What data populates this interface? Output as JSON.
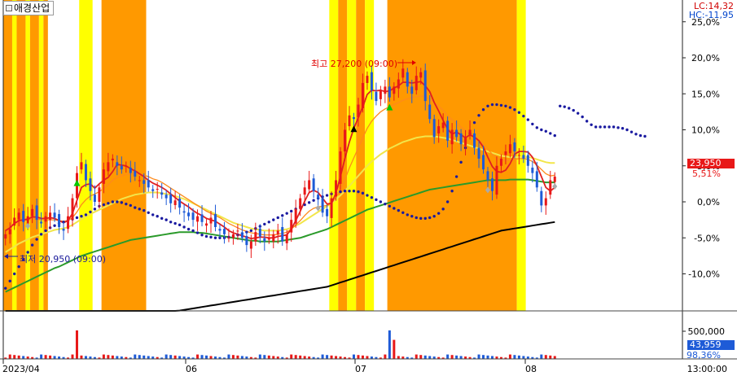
{
  "header": {
    "stock_name": "애경산업",
    "lc_label": "LC:14,32",
    "hc_label": "HC:-11,95"
  },
  "price_axis": {
    "ticks": [
      "25,0%",
      "20,0%",
      "15,0%",
      "10,0%",
      "5,0%",
      "0,0%",
      "-5,0%",
      "-10,0%"
    ]
  },
  "volume_axis": {
    "ticks": [
      "500,000"
    ]
  },
  "current": {
    "price": "23,950",
    "pct": "5,51%",
    "volume": "43,959",
    "volume_pct": "98,36%"
  },
  "annotations": {
    "high": "최고 27,200 (09:00)",
    "low": "최저 20,950 (09:00)"
  },
  "x_axis": {
    "labels": [
      "2023/04",
      "06",
      "07",
      "08"
    ],
    "time": "13:00:00"
  },
  "colors": {
    "up": "#e81818",
    "down": "#1e5bd7",
    "band_orange": "#ff9900",
    "band_yellow": "#ffff00",
    "ma_red": "#e02020",
    "ma_orange": "#ff8a1a",
    "ma_yellow": "#f2e64a",
    "ma_green": "#2a9a2a",
    "ma_black": "#000000",
    "parabolic_sar": "#1a1aa0"
  },
  "chart_data": {
    "type": "line",
    "price": {
      "units": "% change",
      "close_pct": [
        -4.5,
        -3.8,
        -2.2,
        -1.5,
        -2.8,
        -2.0,
        -1.0,
        -2.5,
        -3.0,
        -2.0,
        -1.5,
        -2.2,
        -3.5,
        -4.0,
        -2.0,
        0.5,
        4.0,
        5.5,
        3.0,
        1.5,
        0.0,
        2.0,
        4.5,
        5.5,
        6.0,
        5.0,
        4.5,
        5.0,
        4.0,
        3.5,
        3.0,
        2.5,
        2.0,
        1.5,
        1.8,
        1.0,
        0.5,
        -0.2,
        0.2,
        -0.8,
        -1.5,
        -2.0,
        -2.5,
        -2.0,
        -2.8,
        -3.0,
        -2.2,
        -3.5,
        -4.0,
        -4.5,
        -5.0,
        -4.5,
        -4.0,
        -5.0,
        -6.0,
        -5.5,
        -4.2,
        -4.8,
        -5.5,
        -5.0,
        -4.5,
        -4.0,
        -5.5,
        -4.5,
        -2.5,
        -1.0,
        0.5,
        2.0,
        3.0,
        1.5,
        0.5,
        -1.5,
        -2.0,
        0.5,
        3.0,
        7.0,
        10.0,
        12.0,
        11.5,
        13.5,
        16.5,
        17.5,
        15.5,
        14.0,
        15.5,
        16.0,
        14.5,
        16.0,
        17.0,
        18.5,
        16.0,
        15.0,
        17.5,
        18.0,
        14.0,
        11.5,
        9.0,
        10.5,
        11.0,
        8.5,
        10.0,
        9.0,
        8.0,
        9.0,
        10.0,
        7.5,
        6.0,
        4.5,
        3.0,
        1.5,
        5.0,
        6.0,
        7.0,
        8.0,
        7.0,
        6.5,
        6.0,
        5.0,
        4.0,
        2.0,
        -0.5,
        0.5,
        3.0,
        3.5
      ],
      "ma_red": [
        -4.0,
        -3.6,
        -3.0,
        -2.6,
        -2.5,
        -2.4,
        -2.1,
        -2.1,
        -2.3,
        -2.3,
        -2.2,
        -2.3,
        -2.6,
        -2.9,
        -2.6,
        -1.6,
        0.2,
        2.0,
        2.4,
        2.5,
        1.9,
        2.5,
        3.0,
        3.4,
        4.2,
        5.2,
        5.1,
        5.0,
        4.6,
        4.3,
        3.9,
        3.5,
        3.0,
        2.6,
        2.3,
        2.0,
        1.6,
        1.1,
        0.6,
        0.1,
        -0.3,
        -0.7,
        -1.2,
        -1.6,
        -1.9,
        -2.3,
        -2.5,
        -2.7,
        -3.1,
        -3.5,
        -4.0,
        -4.3,
        -4.5,
        -4.7,
        -4.9,
        -5.1,
        -5.0,
        -4.9,
        -4.9,
        -5.0,
        -5.0,
        -4.8,
        -4.7,
        -4.6,
        -3.8,
        -2.6,
        -1.3,
        0.1,
        1.3,
        1.6,
        1.3,
        0.5,
        -0.3,
        -0.2,
        1.2,
        3.5,
        6.0,
        8.3,
        10.2,
        11.7,
        13.2,
        14.9,
        15.5,
        15.4,
        15.5,
        15.3,
        15.4,
        15.8,
        16.1,
        16.6,
        16.6,
        16.5,
        16.6,
        16.7,
        16.1,
        15.3,
        13.8,
        12.6,
        11.3,
        10.1,
        9.4,
        9.7,
        9.3,
        8.9,
        9.3,
        9.0,
        8.5,
        7.6,
        6.2,
        4.9,
        4.2,
        4.1,
        4.4,
        5.3,
        6.6,
        7.0,
        7.0,
        6.9,
        6.2,
        5.0,
        3.5,
        2.0,
        1.5,
        2.0
      ],
      "ma_orange": [
        -3.5,
        -3.3,
        -3.0,
        -2.7,
        -2.6,
        -2.5,
        -2.4,
        -2.4,
        -2.5,
        -2.5,
        -2.5,
        -2.5,
        -2.6,
        -2.7,
        -2.6,
        -2.2,
        -1.4,
        -0.4,
        0.3,
        0.8,
        1.1,
        1.4,
        1.9,
        2.4,
        3.0,
        3.4,
        3.6,
        3.8,
        3.9,
        3.9,
        3.8,
        3.7,
        3.5,
        3.2,
        3.0,
        2.7,
        2.3,
        1.9,
        1.5,
        1.1,
        0.7,
        0.3,
        -0.1,
        -0.5,
        -0.9,
        -1.3,
        -1.6,
        -1.9,
        -2.2,
        -2.6,
        -3.0,
        -3.3,
        -3.6,
        -3.9,
        -4.1,
        -4.3,
        -4.4,
        -4.5,
        -4.6,
        -4.6,
        -4.6,
        -4.5,
        -4.4,
        -4.2,
        -3.8,
        -3.2,
        -2.6,
        -1.9,
        -1.3,
        -0.9,
        -0.7,
        -0.6,
        -0.5,
        -0.2,
        0.6,
        1.7,
        3.1,
        4.7,
        6.1,
        7.5,
        8.9,
        10.2,
        11.2,
        11.9,
        12.5,
        12.9,
        13.2,
        13.5,
        13.8,
        14.1,
        14.3,
        14.5,
        14.6,
        14.7,
        14.6,
        14.3,
        13.8,
        13.3,
        12.7,
        12.0,
        11.4,
        10.9,
        10.4,
        9.9,
        9.5,
        9.1,
        8.6,
        8.0,
        7.3,
        6.6,
        6.1,
        5.8,
        5.7,
        5.8,
        5.9,
        6.0,
        6.0,
        5.9,
        5.6,
        5.1,
        4.5,
        3.9,
        3.6,
        3.7
      ],
      "ma_yellow": [
        -7.0,
        -6.6,
        -6.2,
        -5.8,
        -5.5,
        -5.2,
        -4.9,
        -4.7,
        -4.5,
        -4.3,
        -4.1,
        -3.9,
        -3.8,
        -3.7,
        -3.5,
        -3.2,
        -2.8,
        -2.4,
        -2.0,
        -1.7,
        -1.4,
        -1.1,
        -0.8,
        -0.5,
        -0.2,
        0.1,
        0.4,
        0.6,
        0.8,
        1.0,
        1.1,
        1.2,
        1.3,
        1.3,
        1.3,
        1.2,
        1.1,
        1.0,
        0.8,
        0.6,
        0.4,
        0.1,
        -0.2,
        -0.5,
        -0.8,
        -1.1,
        -1.4,
        -1.7,
        -2.0,
        -2.3,
        -2.6,
        -2.9,
        -3.1,
        -3.3,
        -3.5,
        -3.7,
        -3.8,
        -3.9,
        -4.0,
        -4.0,
        -4.0,
        -4.0,
        -3.9,
        -3.8,
        -3.6,
        -3.3,
        -3.0,
        -2.6,
        -2.2,
        -1.8,
        -1.4,
        -1.0,
        -0.6,
        -0.2,
        0.3,
        0.9,
        1.5,
        2.2,
        2.9,
        3.6,
        4.3,
        5.0,
        5.6,
        6.1,
        6.6,
        7.0,
        7.4,
        7.7,
        8.0,
        8.3,
        8.5,
        8.7,
        8.9,
        9.0,
        9.1,
        9.1,
        9.1,
        9.0,
        8.9,
        8.8,
        8.6,
        8.4,
        8.2,
        8.0,
        7.8,
        7.6,
        7.4,
        7.2,
        7.0,
        6.8,
        6.6,
        6.4,
        6.3,
        6.2,
        6.2,
        6.2,
        6.2,
        6.2,
        6.1,
        5.9,
        5.7,
        5.5,
        5.4,
        5.4
      ],
      "ma_green": [
        -12.5,
        -12.2,
        -11.9,
        -11.6,
        -11.3,
        -11.0,
        -10.7,
        -10.4,
        -10.1,
        -9.8,
        -9.5,
        -9.2,
        -9.0,
        -8.7,
        -8.4,
        -8.1,
        -7.8,
        -7.5,
        -7.3,
        -7.1,
        -6.9,
        -6.7,
        -6.5,
        -6.3,
        -6.1,
        -5.9,
        -5.7,
        -5.5,
        -5.3,
        -5.2,
        -5.1,
        -5.0,
        -4.9,
        -4.8,
        -4.7,
        -4.6,
        -4.5,
        -4.4,
        -4.3,
        -4.2,
        -4.2,
        -4.2,
        -4.2,
        -4.3,
        -4.3,
        -4.4,
        -4.5,
        -4.6,
        -4.7,
        -4.8,
        -4.9,
        -5.0,
        -5.1,
        -5.2,
        -5.3,
        -5.4,
        -5.4,
        -5.5,
        -5.5,
        -5.5,
        -5.5,
        -5.5,
        -5.4,
        -5.3,
        -5.2,
        -5.1,
        -5.0,
        -4.8,
        -4.6,
        -4.4,
        -4.2,
        -4.0,
        -3.8,
        -3.5,
        -3.2,
        -2.9,
        -2.6,
        -2.3,
        -2.0,
        -1.7,
        -1.4,
        -1.1,
        -0.9,
        -0.7,
        -0.5,
        -0.3,
        -0.1,
        0.1,
        0.3,
        0.5,
        0.7,
        0.9,
        1.1,
        1.3,
        1.5,
        1.7,
        1.8,
        1.9,
        2.0,
        2.1,
        2.2,
        2.3,
        2.4,
        2.5,
        2.6,
        2.7,
        2.8,
        2.9,
        3.0,
        3.0,
        3.0,
        3.0,
        3.0,
        3.1,
        3.1,
        3.1,
        3.1,
        3.1,
        3.0,
        2.9,
        2.8,
        2.7,
        2.7,
        2.7
      ],
      "ma_black": [
        -20.0,
        -19.8,
        -19.6,
        -19.4,
        -19.2,
        -19.0,
        -18.8,
        -18.6,
        -18.4,
        -18.2,
        -18.0,
        -17.9,
        -17.8,
        -17.7,
        -17.6,
        -17.5,
        -17.4,
        -17.3,
        -17.2,
        -17.1,
        -17.0,
        -16.9,
        -16.8,
        -16.7,
        -16.6,
        -16.5,
        -16.4,
        -16.3,
        -16.2,
        -16.1,
        -16.0,
        -15.9,
        -15.8,
        -15.7,
        -15.6,
        -15.5,
        -15.4,
        -15.3,
        -15.2,
        -15.1,
        -15.0,
        -14.9,
        -14.8,
        -14.7,
        -14.6,
        -14.5,
        -14.4,
        -14.3,
        -14.2,
        -14.1,
        -14.0,
        -13.9,
        -13.8,
        -13.7,
        -13.6,
        -13.5,
        -13.4,
        -13.3,
        -13.2,
        -13.1,
        -13.0,
        -12.9,
        -12.8,
        -12.7,
        -12.6,
        -12.5,
        -12.4,
        -12.3,
        -12.2,
        -12.1,
        -12.0,
        -11.9,
        -11.8,
        -11.6,
        -11.4,
        -11.2,
        -11.0,
        -10.8,
        -10.6,
        -10.4,
        -10.2,
        -10.0,
        -9.8,
        -9.6,
        -9.4,
        -9.2,
        -9.0,
        -8.8,
        -8.6,
        -8.4,
        -8.2,
        -8.0,
        -7.8,
        -7.6,
        -7.4,
        -7.2,
        -7.0,
        -6.8,
        -6.6,
        -6.4,
        -6.2,
        -6.0,
        -5.8,
        -5.6,
        -5.4,
        -5.2,
        -5.0,
        -4.8,
        -4.6,
        -4.4,
        -4.2,
        -4.0,
        -3.9,
        -3.8,
        -3.7,
        -3.6,
        -3.5,
        -3.4,
        -3.3,
        -3.2,
        -3.1,
        -3.0,
        -2.9,
        -2.8
      ],
      "parabolic_sar": [
        -12.0,
        -11.0,
        -10.0,
        -9.0,
        -8.0,
        -7.0,
        -6.0,
        -5.2,
        -4.5,
        -4.0,
        -3.6,
        -3.3,
        -3.0,
        -2.8,
        -2.6,
        -2.4,
        -2.2,
        -2.0,
        -1.8,
        -1.4,
        -1.0,
        -0.6,
        -0.4,
        -0.2,
        0.0,
        0.0,
        -0.1,
        -0.3,
        -0.5,
        -0.8,
        -1.0,
        -1.2,
        -1.5,
        -1.8,
        -2.0,
        -2.3,
        -2.5,
        -2.8,
        -3.0,
        -3.2,
        -3.5,
        -3.8,
        -4.0,
        -4.3,
        -4.6,
        -4.8,
        -4.9,
        -5.0,
        -5.0,
        -5.0,
        -4.9,
        -4.8,
        -4.6,
        -4.4,
        -4.2,
        -4.0,
        -3.7,
        -3.4,
        -3.1,
        -2.8,
        -2.5,
        -2.2,
        -1.9,
        -1.6,
        -1.3,
        -1.0,
        -0.7,
        -0.4,
        -0.1,
        0.2,
        0.5,
        0.7,
        0.9,
        1.1,
        1.3,
        1.4,
        1.5,
        1.5,
        1.5,
        1.4,
        1.2,
        0.9,
        0.6,
        0.3,
        0.0,
        -0.3,
        -0.6,
        -0.9,
        -1.2,
        -1.5,
        -1.8,
        -2.0,
        -2.2,
        -2.3,
        -2.3,
        -2.2,
        -2.0,
        -1.6,
        -1.0,
        0.0,
        1.5,
        3.5,
        5.5,
        7.5,
        9.5,
        11.0,
        12.0,
        12.8,
        13.3,
        13.5,
        13.5,
        13.4,
        13.3,
        13.1,
        12.8,
        12.4,
        11.9,
        11.4,
        10.8,
        10.3,
        10.0,
        9.8,
        9.5,
        9.2
      ],
      "ylim": [
        -15,
        27
      ]
    },
    "volume": {
      "tick": 500000,
      "current": 43959
    },
    "shaded_regions": [
      {
        "color": "orange",
        "from": 0,
        "to": 2
      },
      {
        "color": "yellow",
        "from": 2,
        "to": 3
      },
      {
        "color": "orange",
        "from": 3,
        "to": 5
      },
      {
        "color": "yellow",
        "from": 5,
        "to": 6
      },
      {
        "color": "orange",
        "from": 6,
        "to": 8
      },
      {
        "color": "yellow",
        "from": 8,
        "to": 9
      },
      {
        "color": "orange",
        "from": 9,
        "to": 10
      },
      {
        "color": "yellow",
        "from": 17,
        "to": 20
      },
      {
        "color": "orange",
        "from": 22,
        "to": 32
      },
      {
        "color": "yellow",
        "from": 73,
        "to": 75
      },
      {
        "color": "orange",
        "from": 75,
        "to": 77
      },
      {
        "color": "yellow",
        "from": 77,
        "to": 79
      },
      {
        "color": "orange",
        "from": 79,
        "to": 81
      },
      {
        "color": "yellow",
        "from": 81,
        "to": 83
      },
      {
        "color": "orange",
        "from": 86,
        "to": 115
      },
      {
        "color": "yellow",
        "from": 115,
        "to": 117
      }
    ],
    "markers": [
      {
        "type": "up",
        "idx": 16,
        "color": "#00c800"
      },
      {
        "type": "up",
        "idx": 78,
        "color": "#000000"
      },
      {
        "type": "up",
        "idx": 86,
        "color": "#00c800"
      },
      {
        "type": "gray",
        "idx": 5
      },
      {
        "type": "gray",
        "idx": 70
      },
      {
        "type": "gray",
        "idx": 108
      },
      {
        "type": "gray",
        "idx": 132
      }
    ]
  }
}
